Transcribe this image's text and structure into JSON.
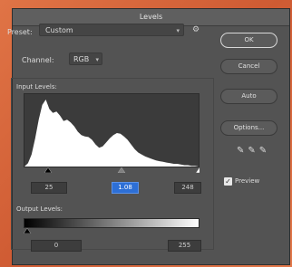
{
  "dialog": {
    "title": "Levels",
    "preset": {
      "label": "Preset:",
      "value": "Custom"
    },
    "channel": {
      "label": "Channel:",
      "value": "RGB"
    },
    "input_levels": {
      "label": "Input Levels:",
      "black": "25",
      "gamma": "1.08",
      "white": "248"
    },
    "output_levels": {
      "label": "Output Levels:",
      "black": "0",
      "white": "255"
    },
    "buttons": {
      "ok": "OK",
      "cancel": "Cancel",
      "auto": "Auto",
      "options": "Options..."
    },
    "preview": {
      "label": "Preview",
      "checked": true
    },
    "colors": {
      "dialog_bg": "#535353",
      "histogram_fill": "#ffffff",
      "histogram_bg": "#3b3b3b",
      "active_field": "#2d6fd6"
    },
    "histogram_profile": [
      0,
      5,
      18,
      42,
      70,
      92,
      100,
      86,
      80,
      82,
      76,
      68,
      70,
      66,
      60,
      52,
      47,
      45,
      44,
      40,
      33,
      28,
      30,
      36,
      42,
      47,
      50,
      49,
      45,
      40,
      33,
      26,
      21,
      18,
      15,
      13,
      11,
      9,
      8,
      7,
      6,
      5,
      4,
      4,
      3,
      2,
      2,
      1,
      1,
      0
    ]
  }
}
